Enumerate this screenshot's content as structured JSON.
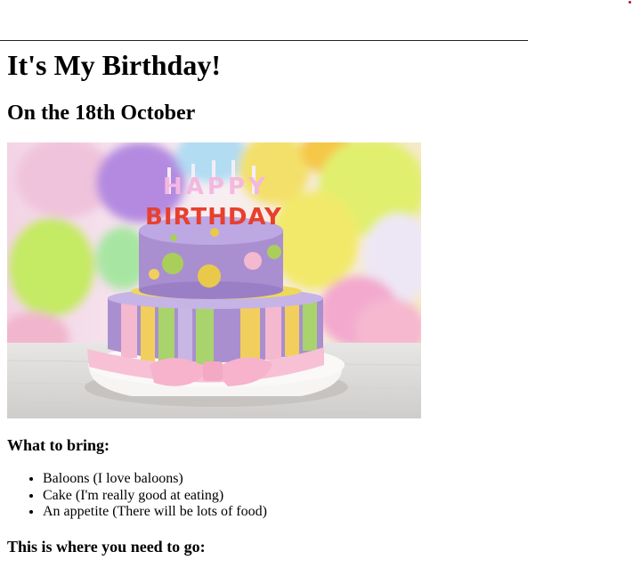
{
  "page": {
    "title": "It's My Birthday!",
    "subtitle": "On the 18th October"
  },
  "image": {
    "subject": "birthday-cake-photo",
    "cake_topper_text": "HAPPY BIRTHDAY",
    "colors": {
      "cake_purple": "#a98fd0",
      "cake_pink": "#f4b8cf",
      "stripe_yellow": "#f2cf5c",
      "stripe_green": "#a9d36c",
      "dot_green": "#a9cf5a",
      "dot_yellow": "#e8c94a"
    }
  },
  "bring": {
    "heading": "What to bring:",
    "items": [
      "Baloons (I love baloons)",
      "Cake (I'm really good at eating)",
      "An appetite (There will be lots of food)"
    ]
  },
  "directions": {
    "heading": "This is where you need to go:"
  }
}
